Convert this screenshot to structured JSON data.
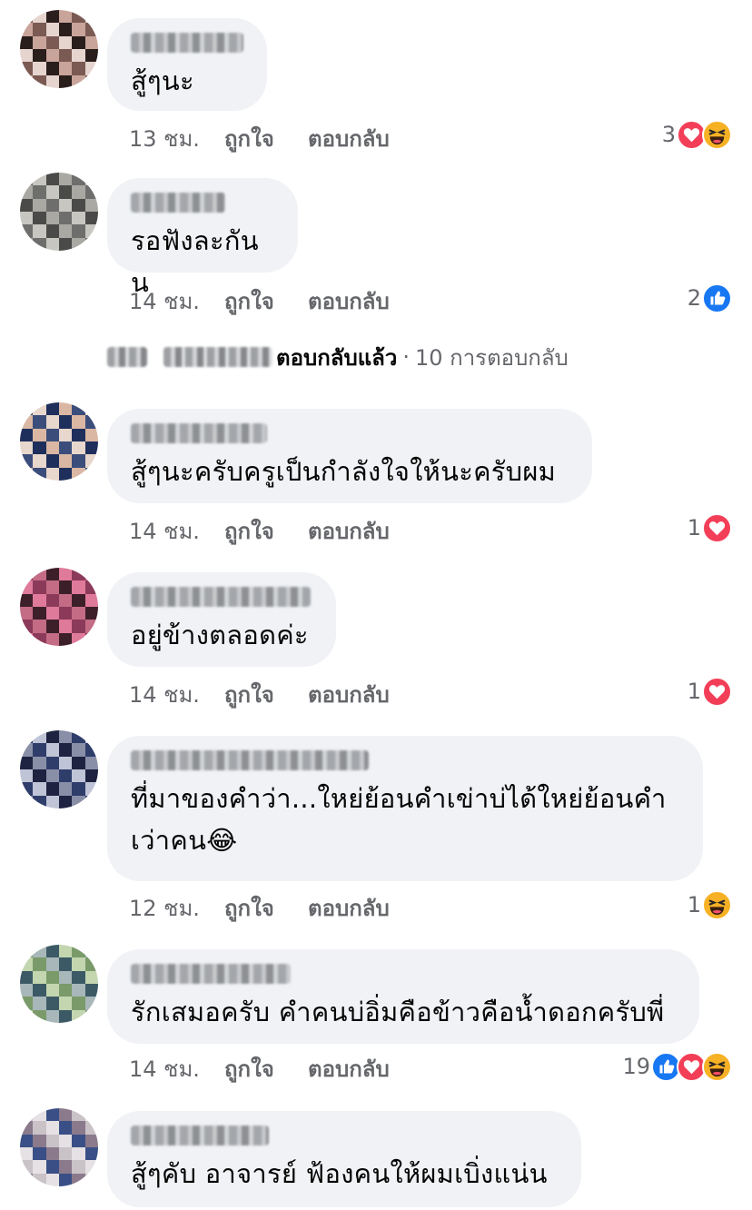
{
  "comments": [
    {
      "text": "สู้ๆนะ",
      "time": "13 ชม.",
      "like": "ถูกใจ",
      "reply": "ตอบกลับ",
      "count": "3",
      "reactions": [
        "love",
        "haha"
      ],
      "avatar": [
        "#7a5a52",
        "#c9a49a",
        "#2a1e1c",
        "#e6d4cf"
      ]
    },
    {
      "text": "รอฟังละกันน",
      "time": "14 ชม.",
      "like": "ถูกใจ",
      "reply": "ตอบกลับ",
      "count": "2",
      "reactions": [
        "like"
      ],
      "avatar": [
        "#6e6e6c",
        "#a9a8a3",
        "#4a4a48",
        "#c7c6c0"
      ]
    },
    {
      "text": "สู้ๆนะครับครูเป็นกำลังใจให้นะครับผม",
      "time": "14 ชม.",
      "like": "ถูกใจ",
      "reply": "ตอบกลับ",
      "count": "1",
      "reactions": [
        "love"
      ],
      "avatar": [
        "#3b4d7a",
        "#d9b7a3",
        "#1f2f5c",
        "#e8d7cc"
      ]
    },
    {
      "text": "อยู่ข้างตลอดค่ะ",
      "time": "14 ชม.",
      "like": "ถูกใจ",
      "reply": "ตอบกลับ",
      "count": "1",
      "reactions": [
        "love"
      ],
      "avatar": [
        "#8c3a5a",
        "#e07a9a",
        "#3d1f2a",
        "#c46c85"
      ]
    },
    {
      "text": "ที่มาของคำว่า...ใหย่ย้อนคำเข่าบ่ได้ใหย่ย้อนคำ\nเว่าคน😂",
      "time": "12 ชม.",
      "like": "ถูกใจ",
      "reply": "ตอบกลับ",
      "count": "1",
      "reactions": [
        "haha"
      ],
      "avatar": [
        "#2e3d6a",
        "#8a8fa8",
        "#1d2340",
        "#bfc4d6"
      ]
    },
    {
      "text": "รักเสมอครับ คำคนบ่อิ่มคือข้าวคือน้ำดอกครับพี่",
      "time": "14 ชม.",
      "like": "ถูกใจ",
      "reply": "ตอบกลับ",
      "count": "19",
      "reactions": [
        "like",
        "love",
        "haha"
      ],
      "avatar": [
        "#7a9a6a",
        "#c3d6b0",
        "#3c5a66",
        "#a8b7b9"
      ]
    },
    {
      "text": "สู้ๆคับ อาจารย์ ฟ้องคนให้ผมเบิ่งแน่น",
      "time": "",
      "like": "",
      "reply": "",
      "count": "",
      "reactions": [],
      "avatar": [
        "#c9c3c8",
        "#8a7a8c",
        "#3a4f86",
        "#e6e1e4"
      ]
    }
  ],
  "replies_summary": {
    "action": "ตอบกลับแล้ว",
    "separator": "·",
    "count": "10 การตอบกลับ"
  },
  "colors": {
    "love": "#f33e58",
    "like": "#1877f2",
    "haha": "#f7b125",
    "bubble": "#f0f2f5",
    "meta": "#65676b"
  }
}
